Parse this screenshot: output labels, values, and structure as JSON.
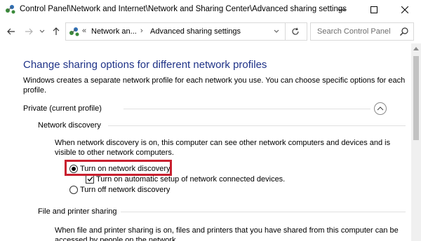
{
  "window": {
    "title": "Control Panel\\Network and Internet\\Network and Sharing Center\\Advanced sharing settings",
    "minimize_icon": "minimize-icon",
    "maximize_icon": "maximize-icon",
    "close_icon": "close-icon"
  },
  "nav": {
    "back_icon": "arrow-left-icon",
    "forward_icon": "arrow-right-icon",
    "recent_icon": "chevron-down-icon",
    "up_icon": "arrow-up-icon",
    "address": {
      "overflow": "«",
      "segments": [
        "Network an...",
        "Advanced sharing settings"
      ],
      "separator": "›"
    },
    "refresh_icon": "refresh-icon",
    "search": {
      "placeholder": "Search Control Panel"
    }
  },
  "main": {
    "title": "Change sharing options for different network profiles",
    "description": "Windows creates a separate network profile for each network you use. You can specific options for each profile.",
    "description_full": "Windows creates a separate network profile for each network you use. You can choose specific options for each profile.",
    "private_profile": {
      "label": "Private (current profile)",
      "expanded": true,
      "network_discovery": {
        "heading": "Network discovery",
        "text": "When network discovery is on, this computer can see other network computers and devices and is visible to other network computers.",
        "options": {
          "on": "Turn on network discovery",
          "auto_setup": "Turn on automatic setup of network connected devices.",
          "off": "Turn off network discovery"
        },
        "selected": "on",
        "auto_setup_checked": true
      },
      "file_printer_sharing": {
        "heading": "File and printer sharing",
        "text": "When file and printer sharing is on, files and printers that you have shared from this computer can be accessed by people on the network."
      }
    }
  },
  "colors": {
    "title_blue": "#1e3287",
    "highlight_red": "#c8202f",
    "separator": "#e1e1e1"
  }
}
